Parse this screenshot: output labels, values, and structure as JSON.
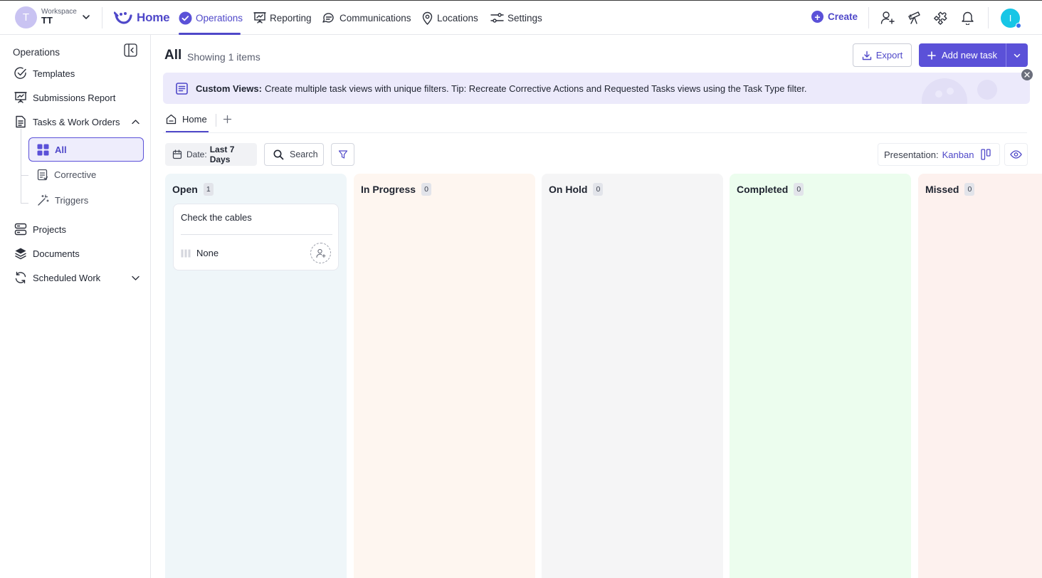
{
  "workspace": {
    "avatar_letter": "T",
    "label": "Workspace",
    "name": "TT"
  },
  "logo": {
    "text": "Home"
  },
  "nav": [
    {
      "label": "Operations",
      "icon": "check-circle-icon",
      "active": true
    },
    {
      "label": "Reporting",
      "icon": "presentation-icon"
    },
    {
      "label": "Communications",
      "icon": "chat-icon"
    },
    {
      "label": "Locations",
      "icon": "map-pin-icon"
    },
    {
      "label": "Settings",
      "icon": "sliders-icon"
    }
  ],
  "topbar": {
    "create_label": "Create",
    "icons": [
      "add-user-icon",
      "telescope-icon",
      "puzzle-icon",
      "bell-icon"
    ],
    "user_avatar_letter": "I"
  },
  "sidebar": {
    "title": "Operations",
    "items": [
      {
        "label": "Templates",
        "icon": "check-circle-icon"
      },
      {
        "label": "Submissions Report",
        "icon": "presentation-icon"
      },
      {
        "label": "Tasks & Work Orders",
        "icon": "document-icon"
      },
      {
        "label": "Projects",
        "icon": "server-icon"
      },
      {
        "label": "Documents",
        "icon": "layers-icon"
      },
      {
        "label": "Scheduled Work",
        "icon": "refresh-icon"
      }
    ],
    "sub_items": [
      {
        "label": "All",
        "icon": "grid-icon",
        "active": true
      },
      {
        "label": "Corrective",
        "icon": "clipboard-icon"
      },
      {
        "label": "Triggers",
        "icon": "magic-wand-icon"
      }
    ]
  },
  "page": {
    "title": "All",
    "subtitle": "Showing 1 items",
    "export_label": "Export",
    "add_task_label": "Add new task"
  },
  "banner": {
    "title": "Custom Views:",
    "text": "Create multiple task views with unique filters. Tip: Recreate Corrective Actions and Requested Tasks views using the Task Type filter."
  },
  "view_tabs": [
    {
      "label": "Home",
      "active": true
    }
  ],
  "filters": {
    "date_label": "Date:",
    "date_value": "Last 7 Days",
    "search_label": "Search"
  },
  "presentation": {
    "label": "Presentation:",
    "value": "Kanban"
  },
  "colors": {
    "accent": "#5b51d8",
    "open": "#eff6f9",
    "in_progress": "#fef6f0",
    "on_hold": "#f5f5f6",
    "completed": "#ecfdee",
    "missed": "#fdf1ee"
  },
  "kanban": {
    "columns": [
      {
        "title": "Open",
        "count": "1",
        "color": "#eff6f9",
        "cards": [
          {
            "title": "Check the cables",
            "priority": "None"
          }
        ]
      },
      {
        "title": "In Progress",
        "count": "0",
        "color": "#fef6f0",
        "cards": []
      },
      {
        "title": "On Hold",
        "count": "0",
        "color": "#f5f5f6",
        "cards": []
      },
      {
        "title": "Completed",
        "count": "0",
        "color": "#ecfdee",
        "cards": []
      },
      {
        "title": "Missed",
        "count": "0",
        "color": "#fdf1ee",
        "cards": []
      }
    ]
  }
}
